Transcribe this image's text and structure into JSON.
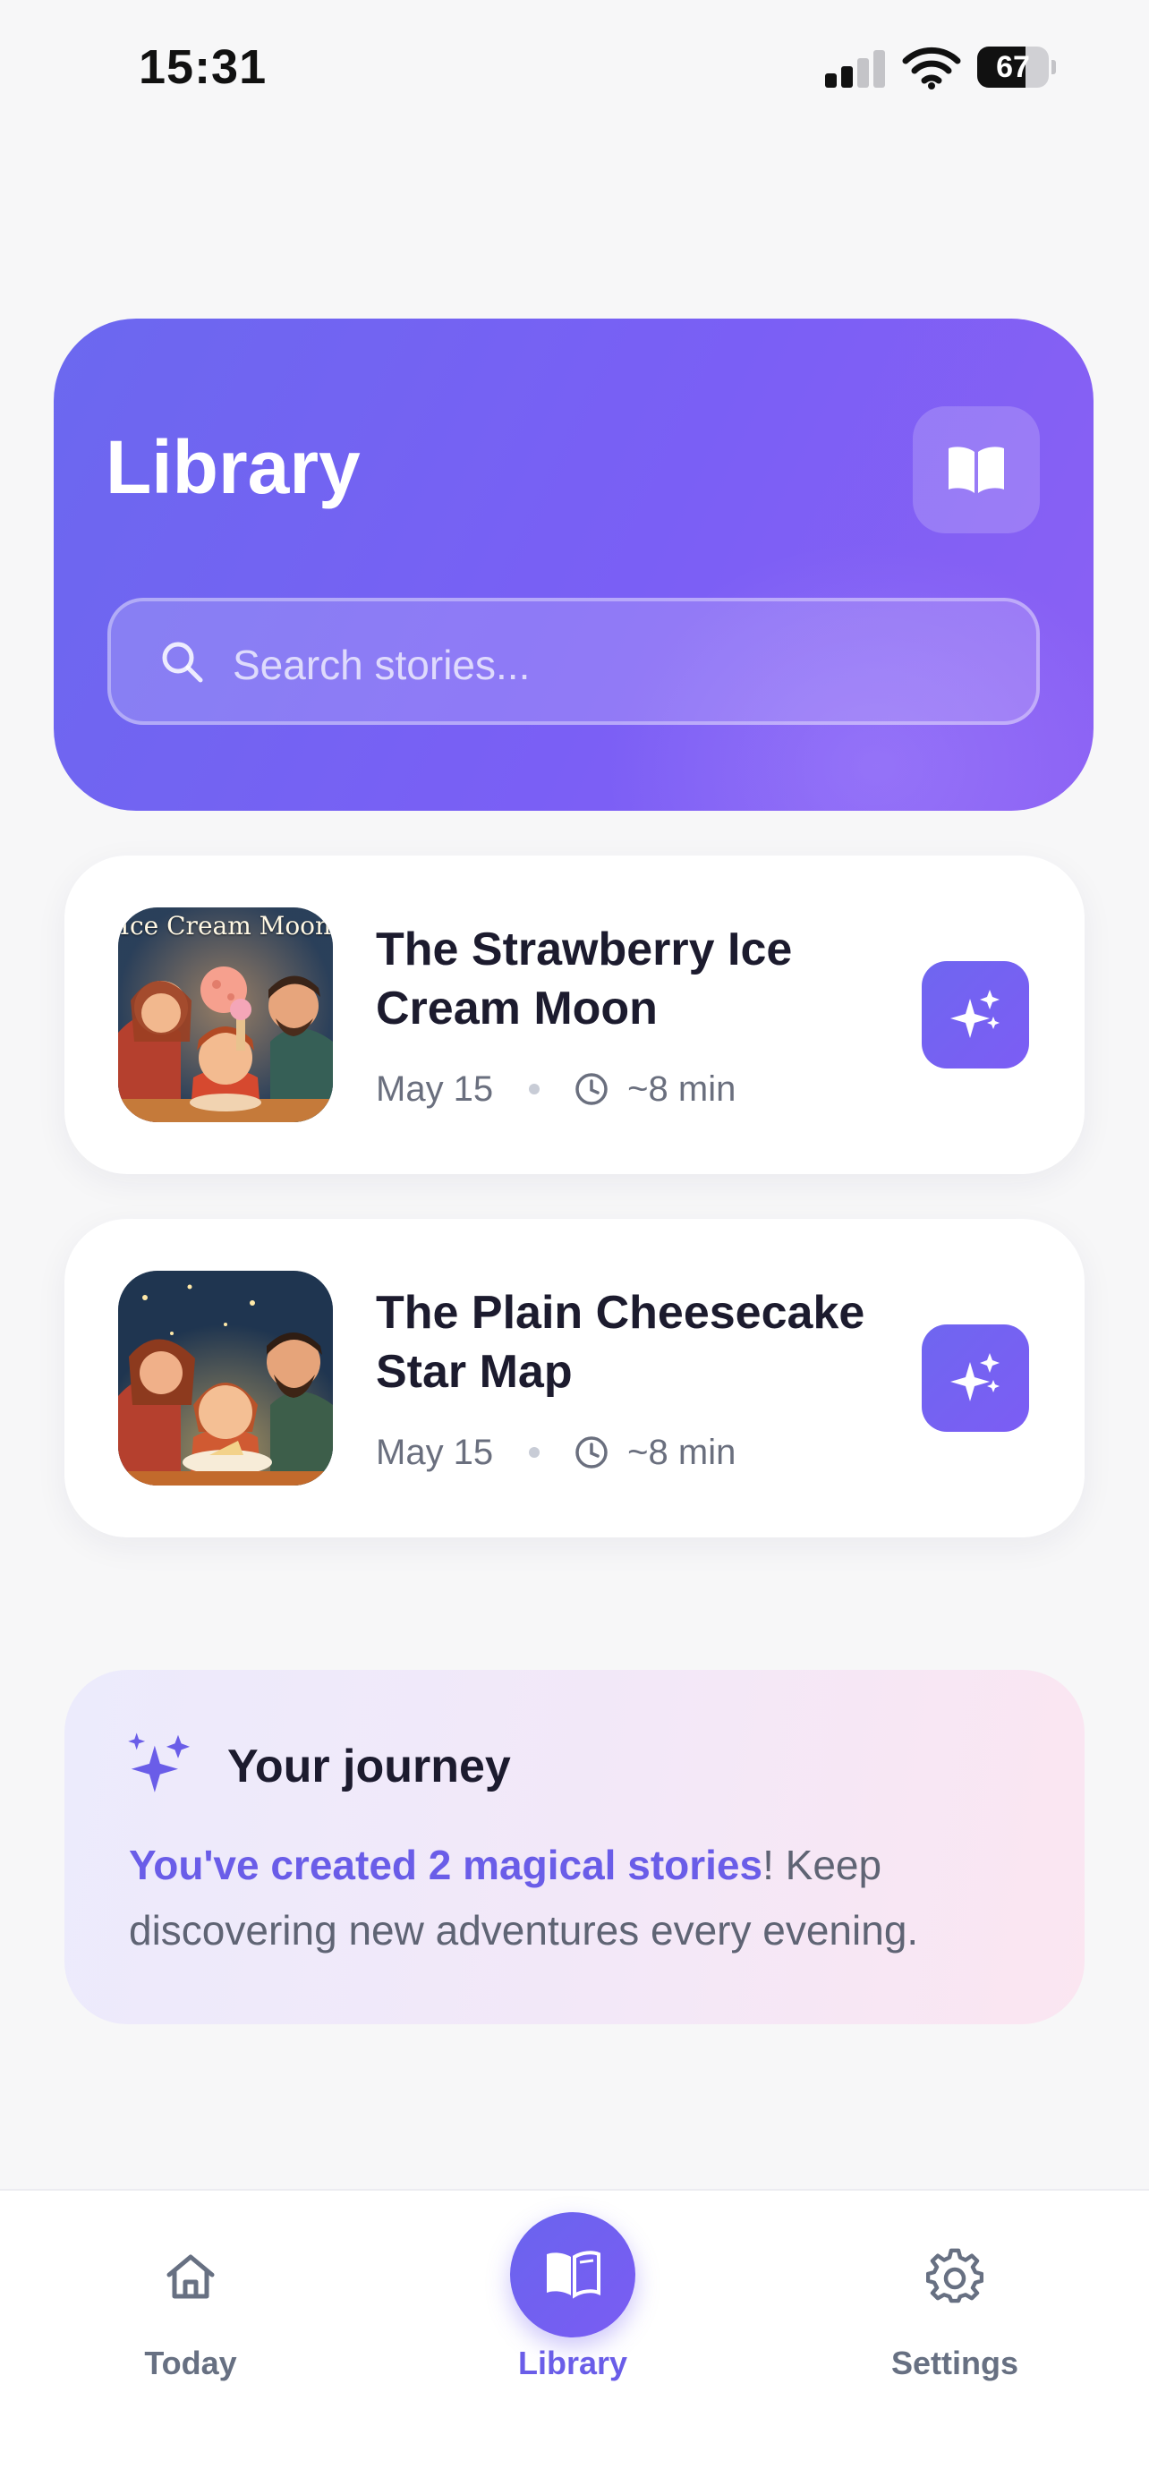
{
  "status_bar": {
    "time": "15:31",
    "battery": "67",
    "battery_level": 0.67
  },
  "header": {
    "title": "Library",
    "icon": "open-book-icon",
    "search_placeholder": "Search stories..."
  },
  "stories": [
    {
      "thumb_text": "Ice Cream Moon",
      "title": "The Strawberry Ice Cream Moon",
      "date": "May 15",
      "duration": "~8 min",
      "action_icon": "sparkles-icon"
    },
    {
      "thumb_text": "",
      "title": "The Plain Cheesecake Star Map",
      "date": "May 15",
      "duration": "~8 min",
      "action_icon": "sparkles-icon"
    }
  ],
  "journey": {
    "title": "Your journey",
    "highlight": "You've created 2 magical stories",
    "text": "! Keep discovering new adventures every evening."
  },
  "nav": {
    "items": [
      {
        "label": "Today",
        "icon": "home-icon"
      },
      {
        "label": "Library",
        "icon": "open-book-icon",
        "active": true
      },
      {
        "label": "Settings",
        "icon": "gear-icon"
      }
    ]
  },
  "colors": {
    "accent": "#6a5de8",
    "header_gradient_start": "#6b68ef",
    "header_gradient_end": "#8b60f4",
    "background": "#f7f7f8"
  }
}
